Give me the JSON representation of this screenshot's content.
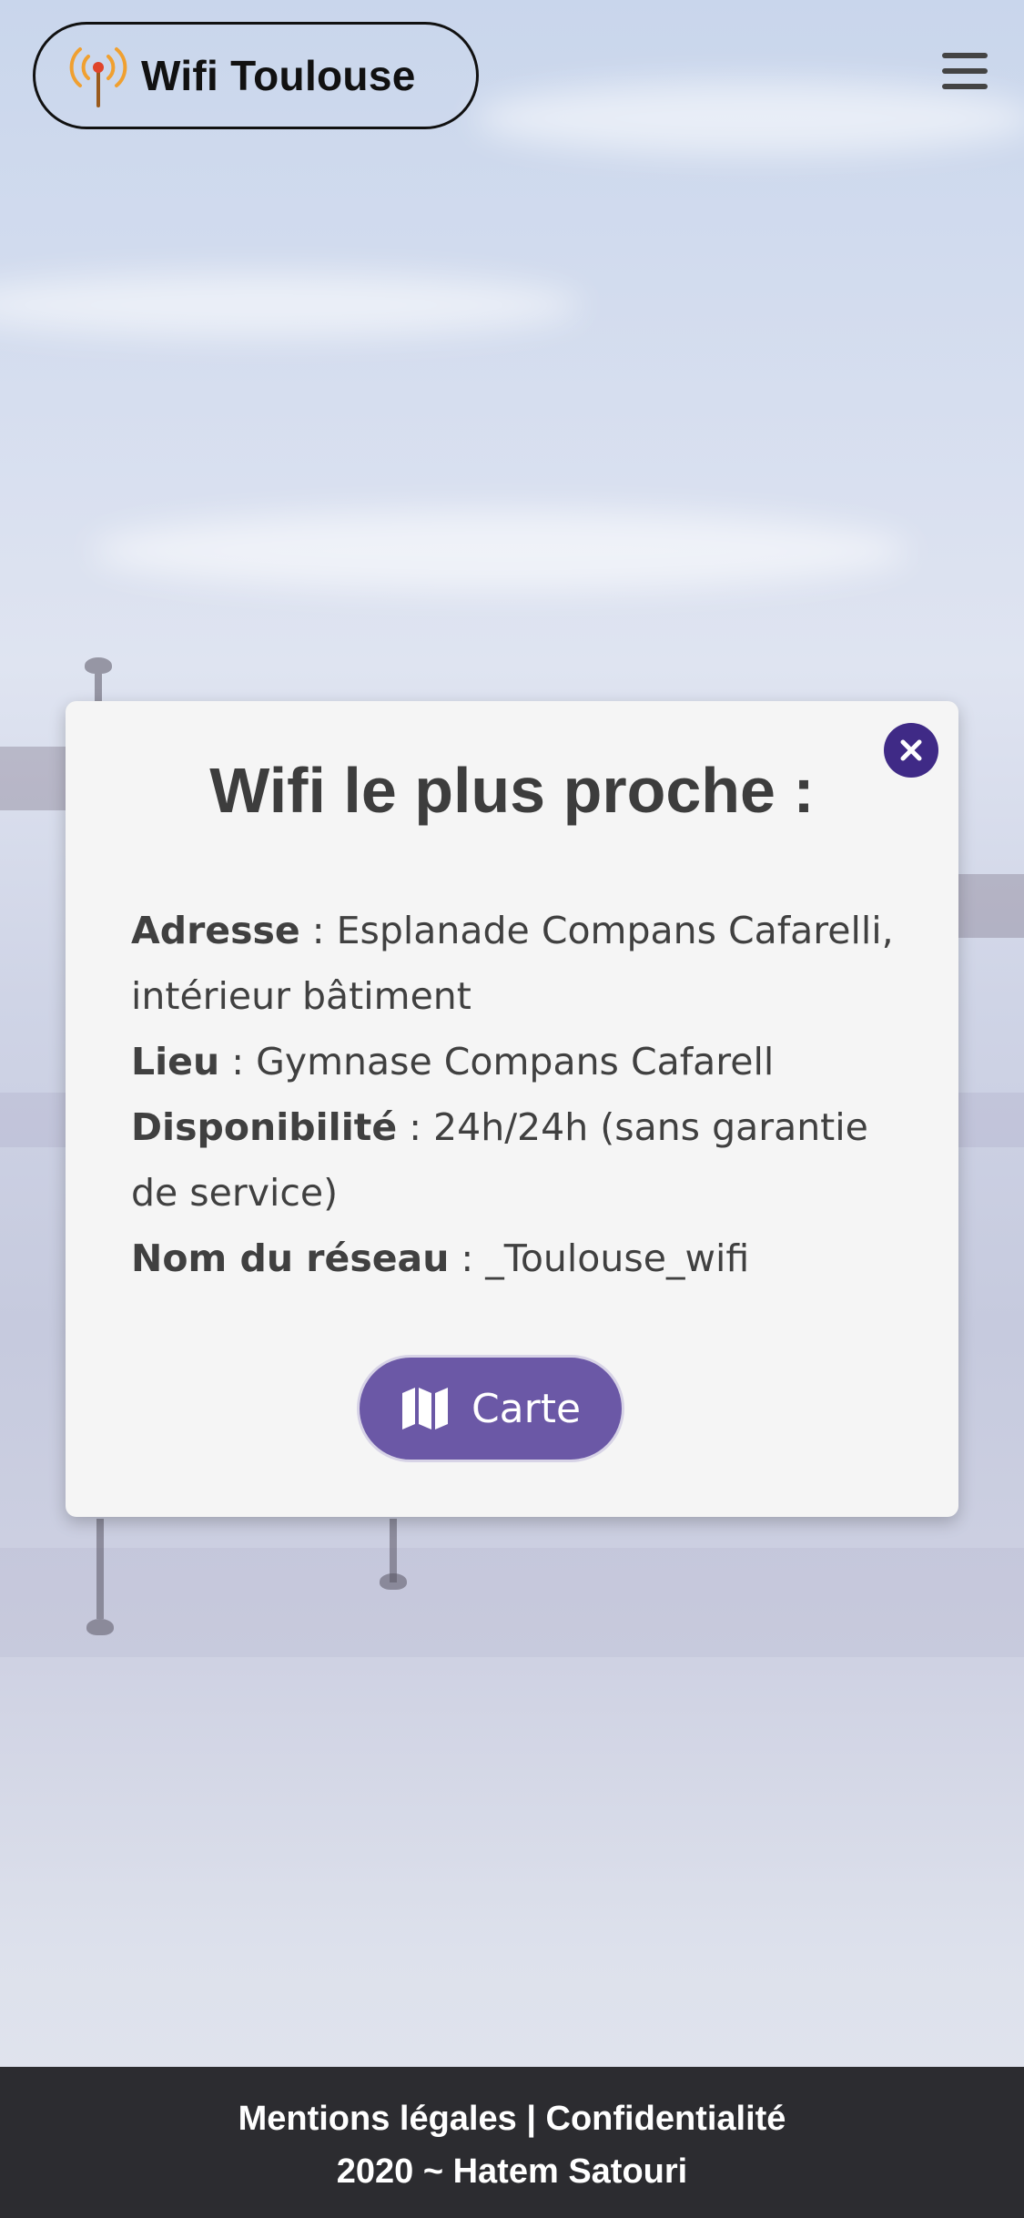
{
  "header": {
    "brand_name": "Wifi Toulouse"
  },
  "modal": {
    "title": "Wifi le plus proche :",
    "fields": [
      {
        "label": "Adresse",
        "value": " : Esplanade Compans Cafarelli, intérieur bâtiment"
      },
      {
        "label": "Lieu",
        "value": " : Gymnase Compans Cafarell"
      },
      {
        "label": "Disponibilité",
        "value": " : 24h/24h (sans garantie de service)"
      },
      {
        "label": "Nom du réseau",
        "value": " : _Toulouse_wifi"
      }
    ],
    "map_button_label": "Carte"
  },
  "footer": {
    "legal_link": "Mentions légales",
    "separator": "|",
    "privacy_link": "Confidentialité",
    "copyright": "2020 ~ Hatem Satouri"
  },
  "colors": {
    "accent_purple": "#6b58a6",
    "close_button": "#3f2a86",
    "footer_bg": "#2c2c30",
    "wifi_icon_orange": "#f0a030"
  },
  "icons": {
    "brand": "wifi-antenna-icon",
    "menu": "hamburger-menu-icon",
    "close": "close-icon",
    "map": "map-icon"
  }
}
